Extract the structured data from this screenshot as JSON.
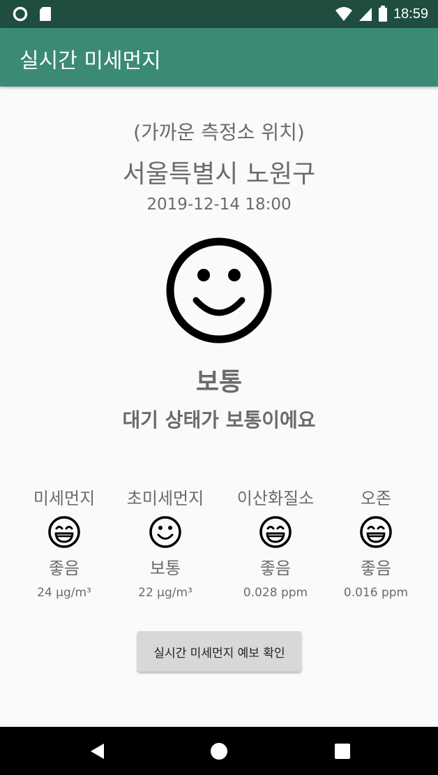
{
  "status_bar": {
    "time": "18:59"
  },
  "app_bar": {
    "title": "실시간 미세먼지"
  },
  "location": {
    "caption": "(가까운 측정소 위치)",
    "name": "서울특별시 노원구",
    "datetime": "2019-12-14 18:00"
  },
  "overall": {
    "icon": "smile-face-icon",
    "status": "보통",
    "message": "대기 상태가 보통이에요"
  },
  "pollutants": [
    {
      "name": "미세먼지",
      "icon": "laughing-face-icon",
      "level": "좋음",
      "value": "24 µg/m³"
    },
    {
      "name": "초미세먼지",
      "icon": "smile-face-icon",
      "level": "보통",
      "value": "22 µg/m³"
    },
    {
      "name": "이산화질소",
      "icon": "laughing-face-icon",
      "level": "좋음",
      "value": "0.028 ppm"
    },
    {
      "name": "오존",
      "icon": "laughing-face-icon",
      "level": "좋음",
      "value": "0.016 ppm"
    }
  ],
  "forecast_button": {
    "label": "실시간 미세먼지 예보 확인"
  },
  "colors": {
    "status_bar": "#1f4d3f",
    "app_bar": "#3a8a76",
    "text": "#6b6b6b"
  }
}
